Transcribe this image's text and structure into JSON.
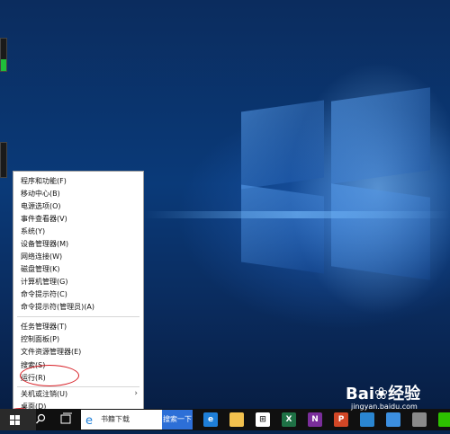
{
  "context_menu": {
    "items": [
      {
        "label": "程序和功能(F)"
      },
      {
        "label": "移动中心(B)"
      },
      {
        "label": "电源选项(O)"
      },
      {
        "label": "事件查看器(V)"
      },
      {
        "label": "系统(Y)"
      },
      {
        "label": "设备管理器(M)"
      },
      {
        "label": "网络连接(W)"
      },
      {
        "label": "磁盘管理(K)"
      },
      {
        "label": "计算机管理(G)"
      },
      {
        "label": "命令提示符(C)"
      },
      {
        "label": "命令提示符(管理员)(A)"
      },
      {
        "label": "任务管理器(T)"
      },
      {
        "label": "控制面板(P)"
      },
      {
        "label": "文件资源管理器(E)"
      },
      {
        "label": "搜索(S)"
      },
      {
        "label": "运行(R)",
        "highlighted": true
      },
      {
        "label": "关机或注销(U)",
        "has_submenu": true
      },
      {
        "label": "桌面(D)"
      }
    ],
    "highlight_color": "#d81f26"
  },
  "taskbar": {
    "search_value": "书籍下载",
    "search_button_label": "搜索一下",
    "apps": [
      {
        "name": "edge-icon",
        "color": "#1e7fd8",
        "glyph": "e"
      },
      {
        "name": "file-explorer-icon",
        "color": "#f2c14e",
        "glyph": ""
      },
      {
        "name": "store-icon",
        "color": "#ffffff",
        "glyph": "⊞"
      },
      {
        "name": "excel-icon",
        "color": "#1e7145",
        "glyph": "X"
      },
      {
        "name": "onenote-icon",
        "color": "#7a2e9b",
        "glyph": "N"
      },
      {
        "name": "powerpoint-icon",
        "color": "#d24726",
        "glyph": "P"
      },
      {
        "name": "photoshop-icon",
        "color": "#2a86d1",
        "glyph": ""
      },
      {
        "name": "app-icon",
        "color": "#3c8fe0",
        "glyph": ""
      },
      {
        "name": "app-icon",
        "color": "#8a8a8a",
        "glyph": ""
      },
      {
        "name": "wechat-icon",
        "color": "#2dc100",
        "glyph": ""
      }
    ]
  },
  "watermark": {
    "main": "Bai❀经验",
    "sub": "jingyan.baidu.com"
  },
  "left_widgets": [
    {
      "level": 0.35
    },
    {
      "level": 0.0
    }
  ],
  "colors": {
    "menu_background": "#ffffff",
    "taskbar_background": "#101010",
    "search_button": "#2d6fd7"
  }
}
